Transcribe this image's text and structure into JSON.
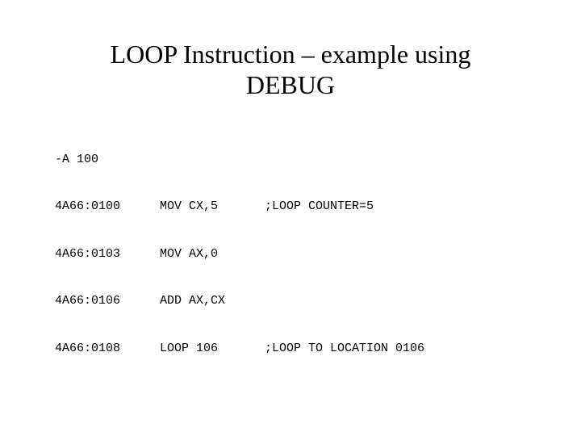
{
  "title_line1": "LOOP Instruction – example using",
  "title_line2": "DEBUG",
  "rows": [
    {
      "addr": "-A 100",
      "instr": "",
      "comment": ""
    },
    {
      "addr": "4A66:0100",
      "instr": "MOV CX,5",
      "comment": ";LOOP COUNTER=5"
    },
    {
      "addr": "4A66:0103",
      "instr": "MOV AX,0",
      "comment": ""
    },
    {
      "addr": "4A66:0106",
      "instr": "ADD AX,CX",
      "comment": ""
    },
    {
      "addr": "4A66:0108",
      "instr": "LOOP 106",
      "comment": ";LOOP TO LOCATION 0106"
    }
  ]
}
